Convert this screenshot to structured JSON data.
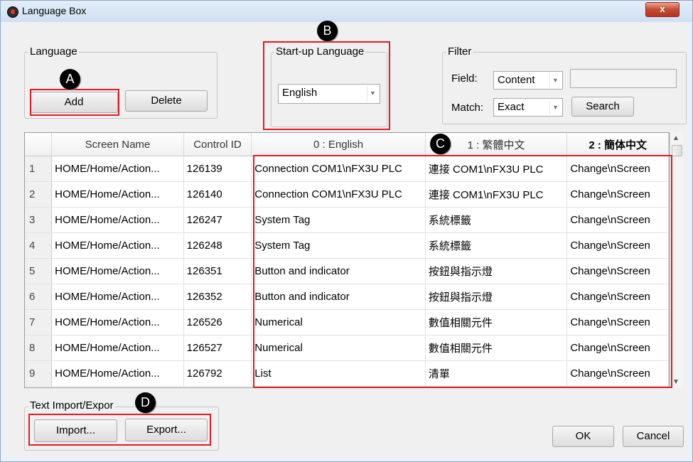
{
  "window": {
    "title": "Language Box",
    "close_symbol": "x"
  },
  "language_group": {
    "label": "Language",
    "add_label": "Add",
    "delete_label": "Delete"
  },
  "startup_group": {
    "label": "Start-up Language",
    "value": "English"
  },
  "filter_group": {
    "label": "Filter",
    "field_label": "Field:",
    "field_value": "Content",
    "match_label": "Match:",
    "match_value": "Exact",
    "search_label": "Search",
    "search_text": ""
  },
  "grid": {
    "columns": [
      "Screen Name",
      "Control ID",
      "0 : English",
      "1 : 繁體中文",
      "2 : 簡体中文"
    ],
    "rows": [
      {
        "num": "1",
        "screen": "HOME/Home/Action...",
        "id": "126139",
        "en": "Connection COM1\\nFX3U PLC",
        "zh_tw": "連接 COM1\\nFX3U PLC",
        "zh_cn": "Change\\nScreen"
      },
      {
        "num": "2",
        "screen": "HOME/Home/Action...",
        "id": "126140",
        "en": "Connection COM1\\nFX3U PLC",
        "zh_tw": "連接 COM1\\nFX3U PLC",
        "zh_cn": "Change\\nScreen"
      },
      {
        "num": "3",
        "screen": "HOME/Home/Action...",
        "id": "126247",
        "en": "System Tag",
        "zh_tw": "系統標籤",
        "zh_cn": "Change\\nScreen"
      },
      {
        "num": "4",
        "screen": "HOME/Home/Action...",
        "id": "126248",
        "en": "System Tag",
        "zh_tw": "系統標籤",
        "zh_cn": "Change\\nScreen"
      },
      {
        "num": "5",
        "screen": "HOME/Home/Action...",
        "id": "126351",
        "en": "Button and indicator",
        "zh_tw": "按鈕與指示燈",
        "zh_cn": "Change\\nScreen"
      },
      {
        "num": "6",
        "screen": "HOME/Home/Action...",
        "id": "126352",
        "en": "Button and indicator",
        "zh_tw": "按鈕與指示燈",
        "zh_cn": "Change\\nScreen"
      },
      {
        "num": "7",
        "screen": "HOME/Home/Action...",
        "id": "126526",
        "en": "Numerical",
        "zh_tw": "數值相關元件",
        "zh_cn": "Change\\nScreen"
      },
      {
        "num": "8",
        "screen": "HOME/Home/Action...",
        "id": "126527",
        "en": "Numerical",
        "zh_tw": "數值相關元件",
        "zh_cn": "Change\\nScreen"
      },
      {
        "num": "9",
        "screen": "HOME/Home/Action...",
        "id": "126792",
        "en": "List",
        "zh_tw": "清單",
        "zh_cn": "Change\\nScreen"
      }
    ]
  },
  "text_group": {
    "label": "Text Import/Expor",
    "import_label": "Import...",
    "export_label": "Export..."
  },
  "footer": {
    "ok_label": "OK",
    "cancel_label": "Cancel"
  },
  "annotations": {
    "a": "A",
    "b": "B",
    "c": "C",
    "d": "D"
  },
  "icons": {
    "app": "app-logo-icon",
    "close": "close-icon",
    "dropdown": "chevron-down-icon",
    "scroll_up": "scroll-up-icon",
    "scroll_down": "scroll-down-icon"
  },
  "colors": {
    "highlight": "#e11b22",
    "badge": "#000000",
    "window_frame": "#eaf1fa"
  }
}
